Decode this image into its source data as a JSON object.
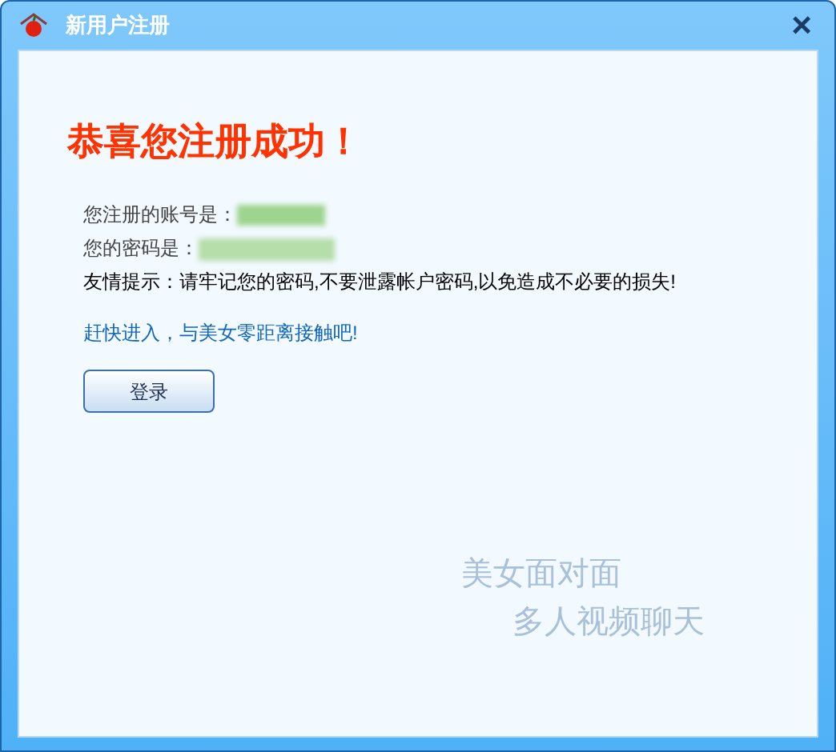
{
  "window": {
    "title": "新用户注册",
    "close": "×"
  },
  "heading": "恭喜您注册成功！",
  "account_label": "您注册的账号是：",
  "password_label": "您的密码是：",
  "tip": "友情提示：请牢记您的密码,不要泄露帐户密码,以免造成不必要的损失!",
  "enter_link": "赶快进入，与美女零距离接触吧!",
  "login_button": "登录",
  "slogan": [
    "美女面对面",
    "多人视频聊天"
  ]
}
